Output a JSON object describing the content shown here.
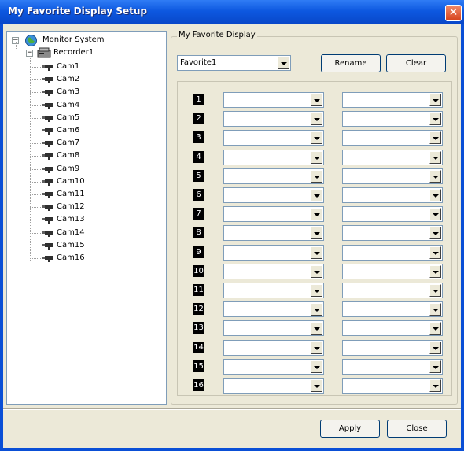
{
  "window": {
    "title": "My Favorite Display Setup"
  },
  "tree": {
    "root": "Monitor System",
    "recorder": "Recorder1",
    "cameras": [
      "Cam1",
      "Cam2",
      "Cam3",
      "Cam4",
      "Cam5",
      "Cam6",
      "Cam7",
      "Cam8",
      "Cam9",
      "Cam10",
      "Cam11",
      "Cam12",
      "Cam13",
      "Cam14",
      "Cam15",
      "Cam16"
    ]
  },
  "favorite": {
    "group_title": "My Favorite Display",
    "selected": "Favorite1",
    "rename_label": "Rename",
    "clear_label": "Clear"
  },
  "slots": [
    "1",
    "2",
    "3",
    "4",
    "5",
    "6",
    "7",
    "8",
    "9",
    "10",
    "11",
    "12",
    "13",
    "14",
    "15",
    "16"
  ],
  "footer": {
    "apply_label": "Apply",
    "close_label": "Close"
  }
}
